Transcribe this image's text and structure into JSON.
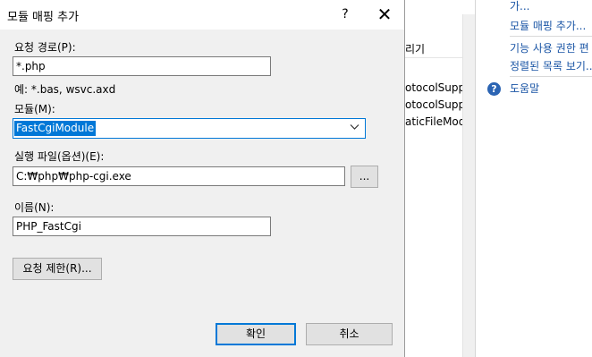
{
  "dialog": {
    "title": "모듈 매핑 추가",
    "help_glyph": "?",
    "close_glyph": "✕",
    "request_path_label": "요청 경로(P):",
    "request_path_value": "*.php",
    "request_path_example": "예: *.bas, wsvc.axd",
    "module_label": "모듈(M):",
    "module_value": "FastCgiModule",
    "executable_label": "실행 파일(옵션)(E):",
    "executable_value": "C:₩php₩php-cgi.exe",
    "browse_label": "...",
    "name_label": "이름(N):",
    "name_value": "PHP_FastCgi",
    "request_restrictions_label": "요청 제한(R)...",
    "ok_label": "확인",
    "cancel_label": "취소"
  },
  "background": {
    "column_header": "리기",
    "rows": [
      "otocolSuppo",
      "otocolSuppo",
      "aticFileModu"
    ],
    "actions": {
      "item_top_partial": "가...",
      "add_module_mapping": "모듈 매핑 추가...",
      "edit_feature_permissions": "기능 사용 권한 편",
      "ordered_list": "정렬된 목록 보기...",
      "help": "도움말",
      "help_icon_glyph": "?"
    }
  }
}
